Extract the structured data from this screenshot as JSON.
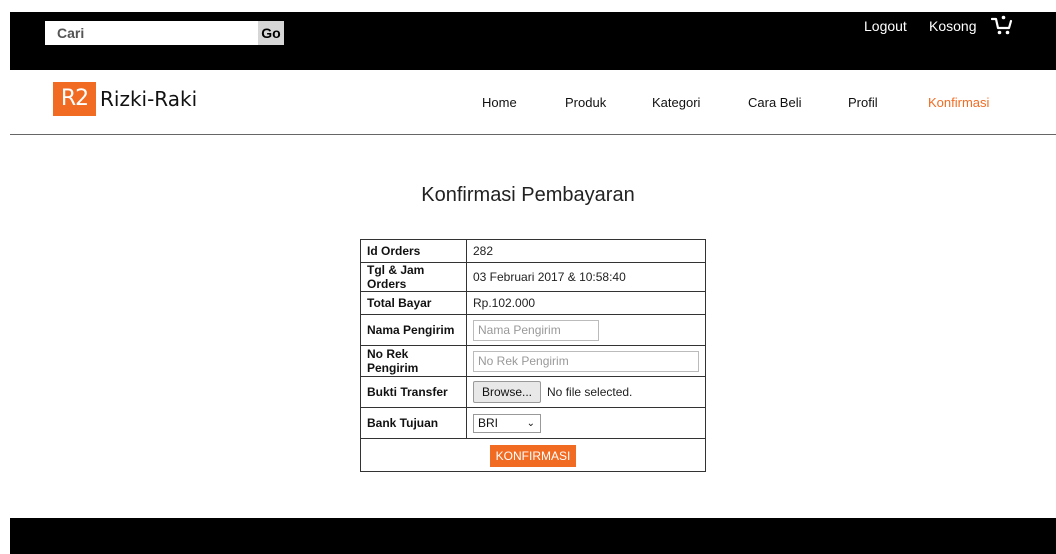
{
  "topbar": {
    "search_placeholder": "Cari",
    "go_label": "Go",
    "logout_label": "Logout",
    "cart_label": "Kosong",
    "cart_icon": "cart-icon"
  },
  "header": {
    "logo_mark": "R2",
    "logo_text": "Rizki-Raki",
    "nav": [
      {
        "label": "Home"
      },
      {
        "label": "Produk"
      },
      {
        "label": "Kategori"
      },
      {
        "label": "Cara Beli"
      },
      {
        "label": "Profil"
      },
      {
        "label": "Konfirmasi",
        "active": true
      }
    ],
    "active_color": "#f26b22"
  },
  "main": {
    "title": "Konfirmasi Pembayaran",
    "form": {
      "id_orders_label": "Id Orders",
      "id_orders_value": "282",
      "tgl_label": "Tgl & Jam Orders",
      "tgl_value": "03 Februari 2017 & 10:58:40",
      "total_label": "Total Bayar",
      "total_value": "Rp.102.000",
      "nama_label": "Nama Pengirim",
      "nama_placeholder": "Nama Pengirim",
      "norek_label": "No Rek Pengirim",
      "norek_placeholder": "No Rek Pengirim",
      "bukti_label": "Bukti Transfer",
      "browse_label": "Browse...",
      "file_status": "No file selected.",
      "bank_label": "Bank Tujuan",
      "bank_selected": "BRI",
      "submit_label": "KONFIRMASI"
    }
  },
  "colors": {
    "accent": "#f26b22",
    "topbar_bg": "#000000",
    "footer_bg": "#000000"
  }
}
